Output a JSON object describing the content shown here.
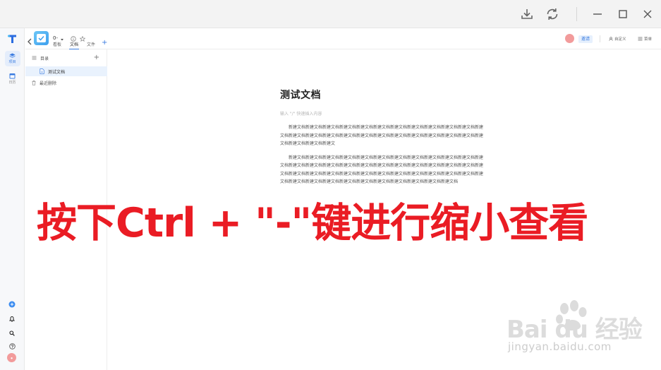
{
  "titlebar": {
    "icons": [
      "download-icon",
      "sync-icon",
      "minimize-icon",
      "maximize-icon",
      "close-icon"
    ]
  },
  "rail": {
    "items": [
      {
        "label": "项目",
        "icon": "cube-icon"
      },
      {
        "label": "日历",
        "icon": "calendar-icon"
      }
    ],
    "bottom_icons": [
      "add-circle-icon",
      "bell-icon",
      "search-icon",
      "help-icon",
      "avatar"
    ]
  },
  "header": {
    "project_name": "0-",
    "tabs": [
      {
        "label": "看板",
        "active": false
      },
      {
        "label": "文档",
        "active": true
      },
      {
        "label": "文件",
        "active": false
      }
    ],
    "invite_label": "邀请",
    "custom_label": "自定义",
    "menu_label": "菜单"
  },
  "sidebar": {
    "directory_label": "目录",
    "doc_item": "测试文档",
    "recent_deleted": "最近删除"
  },
  "document": {
    "title": "测试文档",
    "placeholder": "输入 \"/\" 快速插入内容",
    "paragraph1": "新建文档新建文档新建文档新建文档新建文档新建文档新建文档新建文档新建文档新建文档新建文档新建文档新建文档新建文档新建文档新建文档新建文档新建文档新建文档新建文档新建文档新建文档新建文档新建文档新建文档新建文档新建文",
    "paragraph2": "新建文档新建文档新建文档新建文档新建文档新建文档新建文档新建文档新建文档新建文档新建文档新建文档新建文档新建文档新建文档新建文档新建文档新建文档新建文档新建文档新建文档新建文档新建文档新建文档新建文档新建文档新建文档新建文档新建文档新建文档新建文档新建文档新建文档新建文档新建文档新建文档新建文档新建文档新建文档新建文档新建文档新建文档新建文档新建文档新建文档新建文档"
  },
  "overlay_text": "按下Ctrl + \"-\"键进行缩小查看",
  "watermark": {
    "main": "Bai du 经验",
    "sub": "jingyan.baidu.com"
  },
  "colors": {
    "accent": "#3b7ce0",
    "overlay": "#ea1c24",
    "watermark": "#d4d4d4"
  }
}
